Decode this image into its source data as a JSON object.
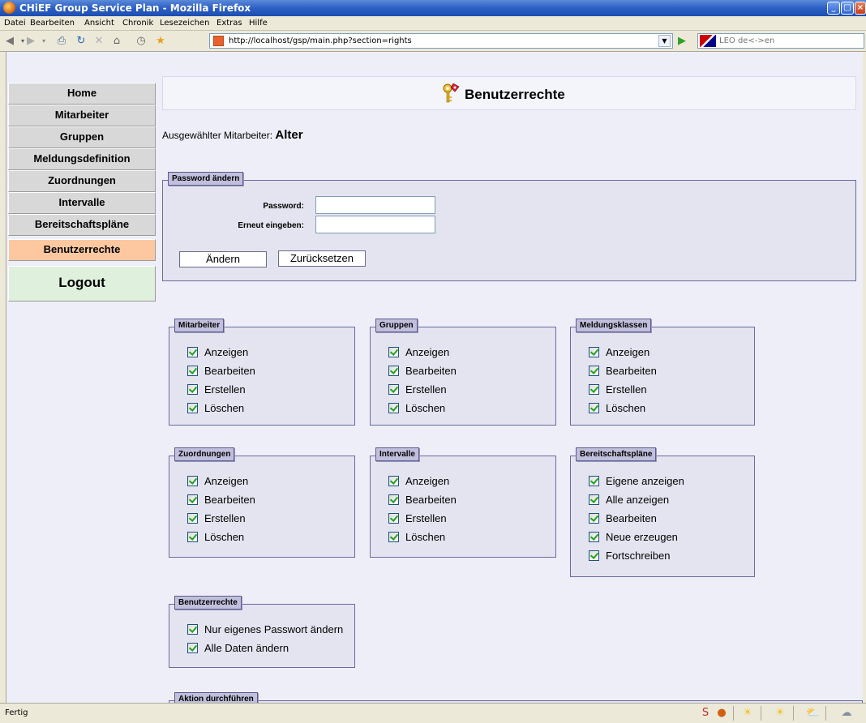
{
  "window": {
    "title": "CHiEF Group Service Plan - Mozilla Firefox",
    "controls": [
      "minimize",
      "maximize",
      "close"
    ]
  },
  "menu": [
    "Datei",
    "Bearbeiten",
    "Ansicht",
    "Chronik",
    "Lesezeichen",
    "Extras",
    "Hilfe"
  ],
  "toolbar": {
    "url": "http://localhost/gsp/main.php?section=rights",
    "search_placeholder": "LEO de<->en"
  },
  "nav": {
    "items": [
      "Home",
      "Mitarbeiter",
      "Gruppen",
      "Meldungsdefinition",
      "Zuordnungen",
      "Intervalle",
      "Bereitschaftspläne",
      "Benutzerrechte"
    ],
    "active": "Benutzerrechte",
    "logout": "Logout"
  },
  "header": {
    "title": "Benutzerrechte"
  },
  "selected": {
    "label": "Ausgewählter Mitarbeiter:",
    "name": "Alter"
  },
  "password": {
    "legend": "Password ändern",
    "password_label": "Password:",
    "repeat_label": "Erneut eingeben:",
    "password_value": "",
    "repeat_value": "",
    "submit": "Ändern",
    "reset": "Zurücksetzen"
  },
  "rights": [
    {
      "legend": "Mitarbeiter",
      "items": [
        {
          "label": "Anzeigen",
          "checked": true
        },
        {
          "label": "Bearbeiten",
          "checked": true
        },
        {
          "label": "Erstellen",
          "checked": true
        },
        {
          "label": "Löschen",
          "checked": true
        }
      ]
    },
    {
      "legend": "Gruppen",
      "items": [
        {
          "label": "Anzeigen",
          "checked": true
        },
        {
          "label": "Bearbeiten",
          "checked": true
        },
        {
          "label": "Erstellen",
          "checked": true
        },
        {
          "label": "Löschen",
          "checked": true
        }
      ]
    },
    {
      "legend": "Meldungsklassen",
      "items": [
        {
          "label": "Anzeigen",
          "checked": true
        },
        {
          "label": "Bearbeiten",
          "checked": true
        },
        {
          "label": "Erstellen",
          "checked": true
        },
        {
          "label": "Löschen",
          "checked": true
        }
      ]
    },
    {
      "legend": "Zuordnungen",
      "items": [
        {
          "label": "Anzeigen",
          "checked": true
        },
        {
          "label": "Bearbeiten",
          "checked": true
        },
        {
          "label": "Erstellen",
          "checked": true
        },
        {
          "label": "Löschen",
          "checked": true
        }
      ]
    },
    {
      "legend": "Intervalle",
      "items": [
        {
          "label": "Anzeigen",
          "checked": true
        },
        {
          "label": "Bearbeiten",
          "checked": true
        },
        {
          "label": "Erstellen",
          "checked": true
        },
        {
          "label": "Löschen",
          "checked": true
        }
      ]
    },
    {
      "legend": "Bereitschaftspläne",
      "items": [
        {
          "label": "Eigene anzeigen",
          "checked": true
        },
        {
          "label": "Alle anzeigen",
          "checked": true
        },
        {
          "label": "Bearbeiten",
          "checked": true
        },
        {
          "label": "Neue erzeugen",
          "checked": true
        },
        {
          "label": "Fortschreiben",
          "checked": true
        }
      ]
    },
    {
      "legend": "Benutzerrechte",
      "items": [
        {
          "label": "Nur eigenes Passwort ändern",
          "checked": true
        },
        {
          "label": "Alle Daten ändern",
          "checked": true
        }
      ]
    }
  ],
  "action": {
    "legend": "Aktion durchführen"
  },
  "status": {
    "text": "Fertig"
  }
}
